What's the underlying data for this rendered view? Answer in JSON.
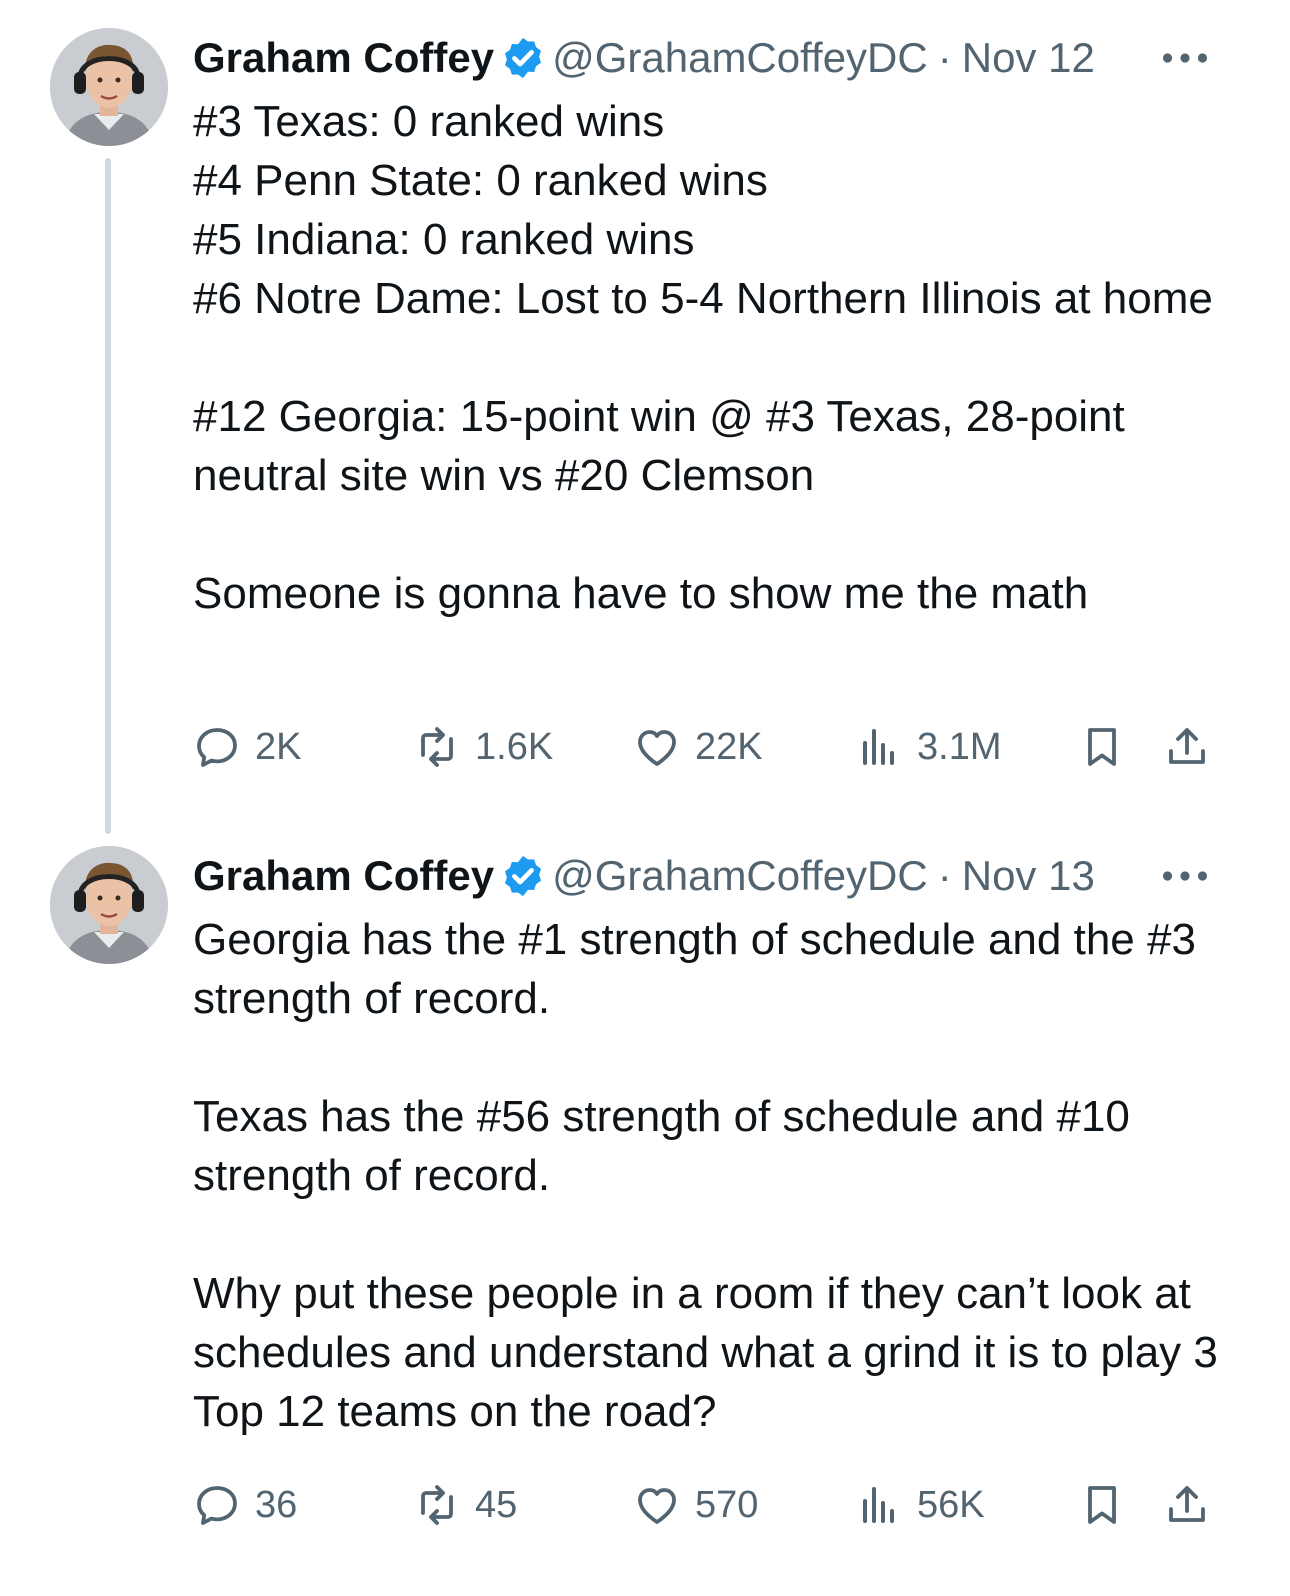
{
  "tweets": [
    {
      "author": {
        "name": "Graham Coffey",
        "handle": "@GrahamCoffeyDC",
        "verified": true
      },
      "separator": "·",
      "date": "Nov 12",
      "text": "#3 Texas: 0 ranked wins\n#4 Penn State: 0 ranked wins\n#5 Indiana: 0 ranked wins\n#6 Notre Dame: Lost to 5-4 Northern Illinois at home\n\n#12 Georgia: 15-point win @ #3 Texas, 28-point neutral site win vs #20 Clemson\n\nSomeone is gonna have to show me the math",
      "stats": {
        "replies": "2K",
        "reposts": "1.6K",
        "likes": "22K",
        "views": "3.1M"
      }
    },
    {
      "author": {
        "name": "Graham Coffey",
        "handle": "@GrahamCoffeyDC",
        "verified": true
      },
      "separator": "·",
      "date": "Nov 13",
      "text": "Georgia has the #1 strength of schedule and the #3 strength of record.\n\nTexas has the #56 strength of schedule and #10 strength of record.\n\nWhy put these people in a room if they can’t look at schedules and understand what a grind it is to play 3 Top 12 teams on the road?",
      "stats": {
        "replies": "36",
        "reposts": "45",
        "likes": "570",
        "views": "56K"
      }
    }
  ],
  "icons": {
    "verified": "verified-badge-icon",
    "more": "more-dots-icon",
    "reply": "reply-icon",
    "repost": "repost-icon",
    "like": "heart-icon",
    "views": "views-icon",
    "bookmark": "bookmark-icon",
    "share": "share-icon"
  },
  "colors": {
    "text": "#0f1419",
    "secondary": "#536471",
    "verified": "#1d9bf0",
    "thread_line": "#cfd9de"
  }
}
